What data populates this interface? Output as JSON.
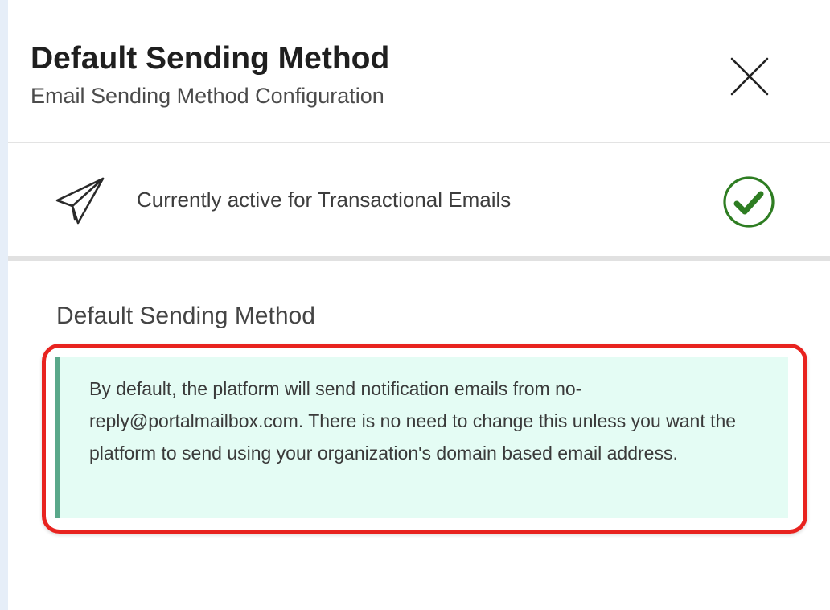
{
  "header": {
    "title": "Default Sending Method",
    "subtitle": "Email Sending Method Configuration"
  },
  "status": {
    "text": "Currently active for Transactional Emails",
    "icon": "paper-plane-icon",
    "indicator_icon": "check-circle-icon",
    "indicator_color": "#2e7d22"
  },
  "section": {
    "title": "Default Sending Method",
    "info_text": "By default, the platform will send notification emails from no-reply@portalmailbox.com. There is no need to change this unless you want the platform to send using your organization's domain based email address."
  },
  "colors": {
    "info_background": "#e4fcf4",
    "info_accent": "#5aa88a",
    "highlight_border": "#e8231f"
  }
}
